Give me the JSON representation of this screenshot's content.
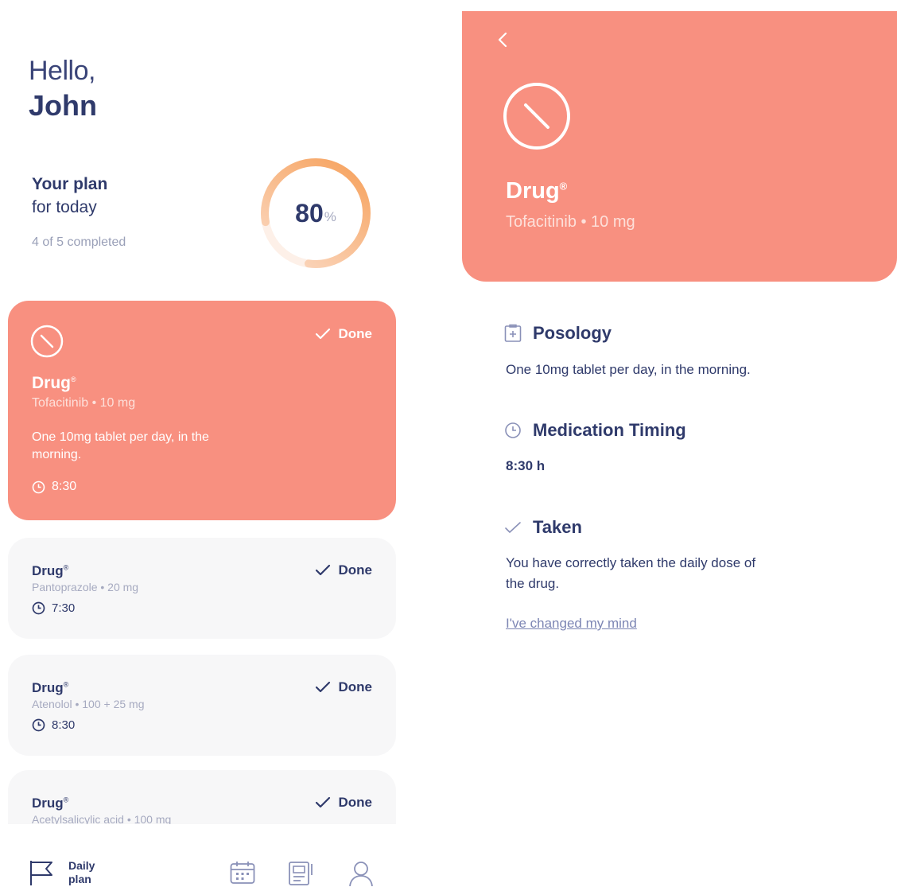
{
  "home": {
    "greeting": "Hello,",
    "name": "John",
    "plan_title_1": "Your plan",
    "plan_title_2": "for today",
    "plan_sub": "4 of 5 completed",
    "progress": {
      "value": "80",
      "unit": "%",
      "fraction": 0.8
    },
    "colors": {
      "accent": "#f89080",
      "navy": "#2f3a6b",
      "card_bg": "#f7f7f8",
      "ring_start": "#f6a05a",
      "ring_end": "#fbdcc8"
    },
    "cards": [
      {
        "drug": "Drug",
        "reg": "®",
        "dose": "Tofacitinib • 10 mg",
        "desc": "One 10mg tablet per day, in the morning.",
        "time": "8:30",
        "status": "Done",
        "active": true
      },
      {
        "drug": "Drug",
        "reg": "®",
        "dose": "Pantoprazole • 20 mg",
        "time": "7:30",
        "status": "Done"
      },
      {
        "drug": "Drug",
        "reg": "®",
        "dose": "Atenolol • 100 + 25 mg",
        "time": "8:30",
        "status": "Done"
      },
      {
        "drug": "Drug",
        "reg": "®",
        "dose": "Acetylsalicylic acid • 100 mg",
        "time": "",
        "status": "Done"
      }
    ],
    "tabbar": {
      "daily_label_1": "Daily",
      "daily_label_2": "plan",
      "icons": [
        "flag-icon",
        "calendar-icon",
        "notebook-icon",
        "profile-icon"
      ]
    }
  },
  "detail": {
    "drug": "Drug",
    "reg": "®",
    "dose": "Tofacitinib • 10 mg",
    "sections": {
      "posology_title": "Posology",
      "posology_text": "One 10mg tablet per day, in the morning.",
      "timing_title": "Medication Timing",
      "timing_text": "8:30 h",
      "taken_title": "Taken",
      "taken_text_1": "You have correctly taken the daily dose of",
      "taken_text_2": "the drug."
    },
    "link": "I've changed my mind"
  }
}
